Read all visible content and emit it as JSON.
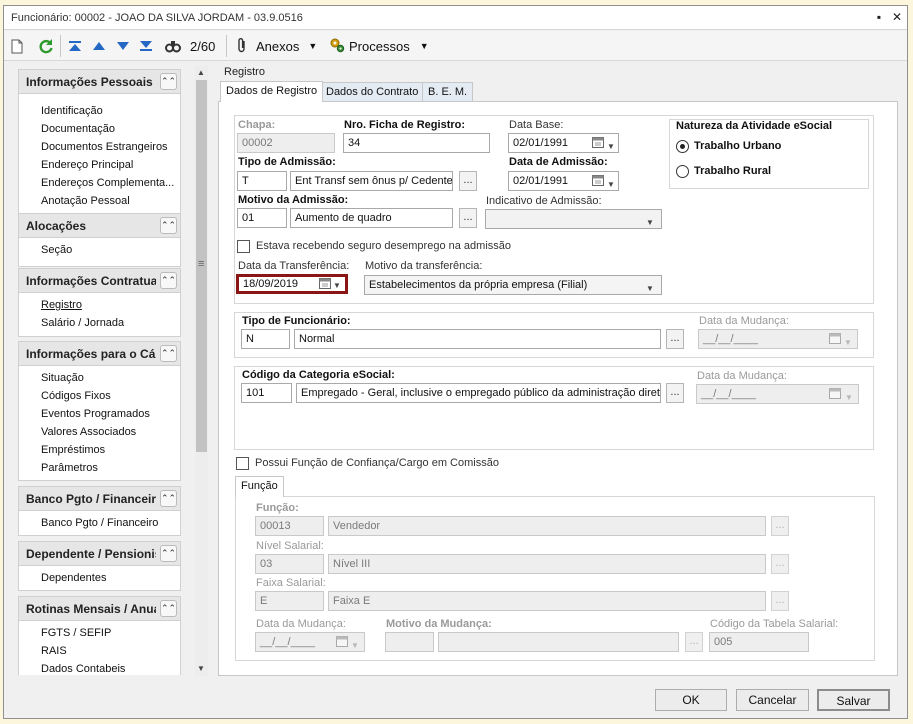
{
  "window": {
    "title": "Funcionário: 00002 - JOAO DA SILVA JORDAM - 03.9.0516"
  },
  "toolbar": {
    "counter": "2/60",
    "anexos": "Anexos",
    "processos": "Processos"
  },
  "sidebar": {
    "groups": [
      {
        "title": "Informações Pessoais",
        "items": [
          "Identificação",
          "Documentação",
          "Documentos Estrangeiros",
          "Endereço Principal",
          "Endereços Complementa...",
          "Anotação Pessoal"
        ]
      },
      {
        "title": "Alocações",
        "items": [
          "Seção"
        ]
      },
      {
        "title": "Informações Contratua",
        "items": [
          "Registro",
          "Salário / Jornada"
        ]
      },
      {
        "title": "Informações para o Cál",
        "items": [
          "Situação",
          "Códigos Fixos",
          "Eventos Programados",
          "Valores Associados",
          "Empréstimos",
          "Parâmetros"
        ]
      },
      {
        "title": "Banco Pgto / Financeiro",
        "items": [
          "Banco Pgto / Financeiro"
        ]
      },
      {
        "title": "Dependente / Pensionis",
        "items": [
          "Dependentes"
        ]
      },
      {
        "title": "Rotinas Mensais / Anua",
        "items": [
          "FGTS / SEFIP",
          "RAIS",
          "Dados Contabeis"
        ]
      }
    ]
  },
  "section_title": "Registro",
  "tabs": [
    "Dados de Registro",
    "Dados do Contrato",
    "B. E. M."
  ],
  "registro": {
    "chapa_label": "Chapa:",
    "chapa": "00002",
    "ficha_label": "Nro. Ficha de Registro:",
    "ficha": "34",
    "database_label": "Data Base:",
    "database": "02/01/1991",
    "tipo_adm_label": "Tipo de Admissão:",
    "tipo_adm_code": "T",
    "tipo_adm_desc": "Ent Transf sem ônus p/ Cedente",
    "data_adm_label": "Data de Admissão:",
    "data_adm": "02/01/1991",
    "motivo_adm_label": "Motivo da Admissão:",
    "motivo_adm_code": "01",
    "motivo_adm_desc": "Aumento de quadro",
    "indicativo_label": "Indicativo de Admissão:",
    "seguro_label": "Estava recebendo seguro desemprego na admissão",
    "data_transf_label": "Data da Transferência:",
    "data_transf": "18/09/2019",
    "motivo_transf_label": "Motivo da transferência:",
    "motivo_transf": "Estabelecimentos da própria empresa (Filial)"
  },
  "natureza": {
    "title": "Natureza da Atividade eSocial",
    "opt1": "Trabalho Urbano",
    "opt2": "Trabalho Rural"
  },
  "tipo_func": {
    "label": "Tipo de Funcionário:",
    "code": "N",
    "desc": "Normal",
    "mudanca_label": "Data da Mudança:",
    "mudanca": "__/__/____"
  },
  "categoria": {
    "label": "Código da Categoria eSocial:",
    "code": "101",
    "desc": "Empregado - Geral, inclusive o empregado público da administração direta o",
    "mudanca_label": "Data da Mudança:",
    "mudanca": "__/__/____"
  },
  "confianca_label": "Possui Função de Confiança/Cargo em Comissão",
  "funcao_tab": "Função",
  "funcao": {
    "funcao_label": "Função:",
    "funcao_code": "00013",
    "funcao_desc": "Vendedor",
    "nivel_label": "Nível Salarial:",
    "nivel_code": "03",
    "nivel_desc": "Nível III",
    "faixa_label": "Faixa Salarial:",
    "faixa_code": "E",
    "faixa_desc": "Faixa E",
    "mudanca_label": "Data da Mudança:",
    "mudanca": "__/__/____",
    "motivo_label": "Motivo da Mudança:",
    "tabela_label": "Código da Tabela Salarial:",
    "tabela": "005"
  },
  "buttons": {
    "ok": "OK",
    "cancel": "Cancelar",
    "save": "Salvar"
  }
}
